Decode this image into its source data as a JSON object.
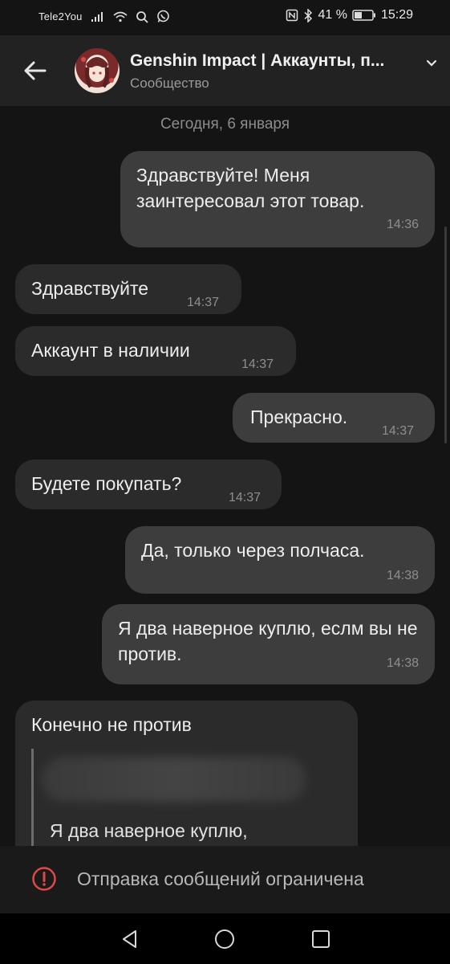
{
  "status": {
    "carrier": "Tele2You",
    "battery": "41 %",
    "time": "15:29"
  },
  "header": {
    "title": "Genshin Impact | Аккаунты, п...",
    "subtitle": "Сообщество"
  },
  "chat": {
    "date_separator": "Сегодня, 6 января",
    "messages": [
      {
        "text": "Здравствуйте! Меня заинтересовал этот товар.",
        "time": "14:36"
      },
      {
        "text": "Здравствуйте",
        "time": "14:37"
      },
      {
        "text": "Аккаунт в наличии",
        "time": "14:37"
      },
      {
        "text": "Прекрасно.",
        "time": "14:37"
      },
      {
        "text": "Будете покупать?",
        "time": "14:37"
      },
      {
        "text": "Да, только через полчаса.",
        "time": "14:38"
      },
      {
        "text": "Я два наверное куплю, еслм вы не против.",
        "time": "14:38"
      },
      {
        "text": "Конечно не против",
        "quote": "Я два наверное куплю,"
      }
    ]
  },
  "footer": {
    "restricted_text": "Отправка сообщений ограничена"
  },
  "colors": {
    "accent_warning": "#e04848",
    "bubble_out": "#3d3d3d",
    "bubble_in": "#2b2b2b"
  },
  "icons": [
    "signal-icon",
    "wifi-icon",
    "search-icon",
    "whatsapp-icon",
    "nfc-icon",
    "bluetooth-icon",
    "battery-icon",
    "back-arrow-icon",
    "chevron-down-icon",
    "warning-icon",
    "nav-back-icon",
    "nav-home-icon",
    "nav-recents-icon"
  ]
}
